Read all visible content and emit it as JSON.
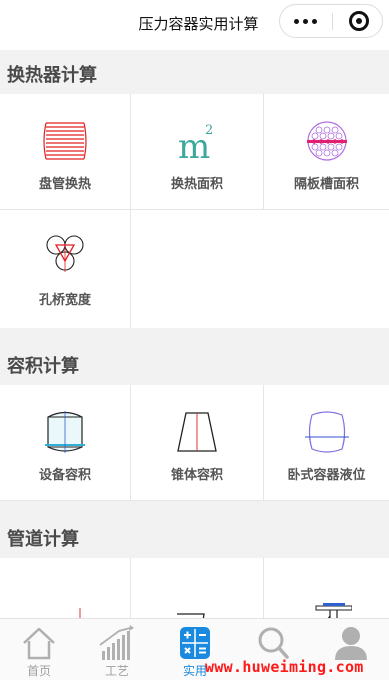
{
  "app": {
    "title": "压力容器实用计算"
  },
  "sections": [
    {
      "title": "换热器计算",
      "items": [
        {
          "label": "盘管换热",
          "icon": "coil-icon"
        },
        {
          "label": "换热面积",
          "icon": "area-m2-icon"
        },
        {
          "label": "隔板槽面积",
          "icon": "tube-sheet-icon"
        },
        {
          "label": "孔桥宽度",
          "icon": "hole-bridge-icon"
        }
      ]
    },
    {
      "title": "容积计算",
      "items": [
        {
          "label": "设备容积",
          "icon": "vessel-icon"
        },
        {
          "label": "锥体容积",
          "icon": "cone-icon"
        },
        {
          "label": "卧式容器液位",
          "icon": "horizontal-vessel-icon"
        }
      ]
    },
    {
      "title": "管道计算",
      "items": [
        {
          "label": "",
          "icon": "pipe-line-icon"
        },
        {
          "label": "",
          "icon": "elbow-icon"
        },
        {
          "label": "",
          "icon": "branch-pipe-icon"
        }
      ]
    }
  ],
  "tabbar": [
    {
      "label": "首页",
      "icon": "home-icon",
      "active": false
    },
    {
      "label": "工艺",
      "icon": "bar-chart-icon",
      "active": false
    },
    {
      "label": "实用",
      "icon": "calculator-icon",
      "active": true
    },
    {
      "label": "",
      "icon": "search-icon",
      "active": false
    },
    {
      "label": "",
      "icon": "user-icon",
      "active": false
    }
  ],
  "watermark": "www.huweiming.com",
  "colors": {
    "accent": "#1a8ae0",
    "section_bg": "#f2f2f2",
    "watermark": "#ff1a1a"
  }
}
